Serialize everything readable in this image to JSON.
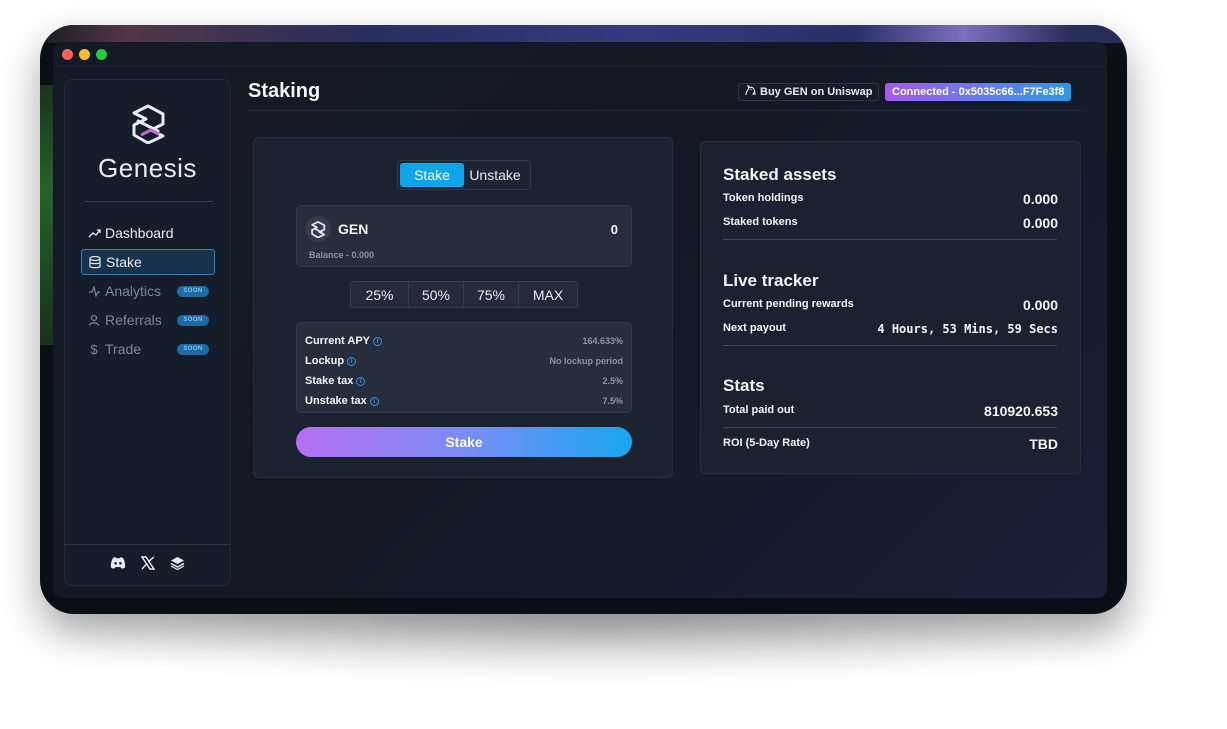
{
  "window": {
    "controls": [
      "close",
      "minimize",
      "zoom"
    ]
  },
  "sidebar": {
    "brand": "Genesis",
    "logo_icon": "genesis-logo-icon",
    "nav": [
      {
        "label": "Dashboard",
        "icon": "trend-icon",
        "active": false,
        "soon": false
      },
      {
        "label": "Stake",
        "icon": "database-icon",
        "active": true,
        "soon": false
      },
      {
        "label": "Analytics",
        "icon": "pulse-icon",
        "active": false,
        "soon": true
      },
      {
        "label": "Referrals",
        "icon": "user-icon",
        "active": false,
        "soon": true
      },
      {
        "label": "Trade",
        "icon": "dollar-icon",
        "active": false,
        "soon": true
      }
    ],
    "soon_badge": "SOON",
    "socials": [
      "discord-icon",
      "x-icon",
      "layers-icon"
    ]
  },
  "header": {
    "title": "Staking",
    "uniswap_label": "Buy GEN on Uniswap",
    "uniswap_icon": "unicorn-icon",
    "connected_label": "Connected - 0x5035c66...F7Fe3f8"
  },
  "stake_panel": {
    "tabs": {
      "stake": "Stake",
      "unstake": "Unstake",
      "selected": "Stake"
    },
    "token": {
      "name": "GEN",
      "amount": "0",
      "balance": "Balance - 0.000"
    },
    "percents": [
      "25%",
      "50%",
      "75%",
      "MAX"
    ],
    "info": [
      {
        "label": "Current APY",
        "value": "164.633%"
      },
      {
        "label": "Lockup",
        "value": "No lockup period"
      },
      {
        "label": "Stake tax",
        "value": "2.5%"
      },
      {
        "label": "Unstake tax",
        "value": "7.5%"
      }
    ],
    "submit_label": "Stake"
  },
  "stats_panel": {
    "staked_assets": {
      "title": "Staked assets",
      "rows": [
        {
          "label": "Token holdings",
          "value": "0.000"
        },
        {
          "label": "Staked tokens",
          "value": "0.000"
        }
      ]
    },
    "live_tracker": {
      "title": "Live tracker",
      "rows": [
        {
          "label": "Current pending rewards",
          "value": "0.000"
        },
        {
          "label": "Next payout",
          "value": "4 Hours, 53 Mins, 59 Secs"
        }
      ]
    },
    "stats": {
      "title": "Stats",
      "rows": [
        {
          "label": "Total paid out",
          "value": "810920.653"
        },
        {
          "label": "ROI (5-Day Rate)",
          "value": "TBD"
        }
      ]
    }
  },
  "colors": {
    "accent": "#0ea5e9",
    "gradient_start": "#b66ff5",
    "gradient_end": "#18a6ef",
    "background": "#121925"
  }
}
